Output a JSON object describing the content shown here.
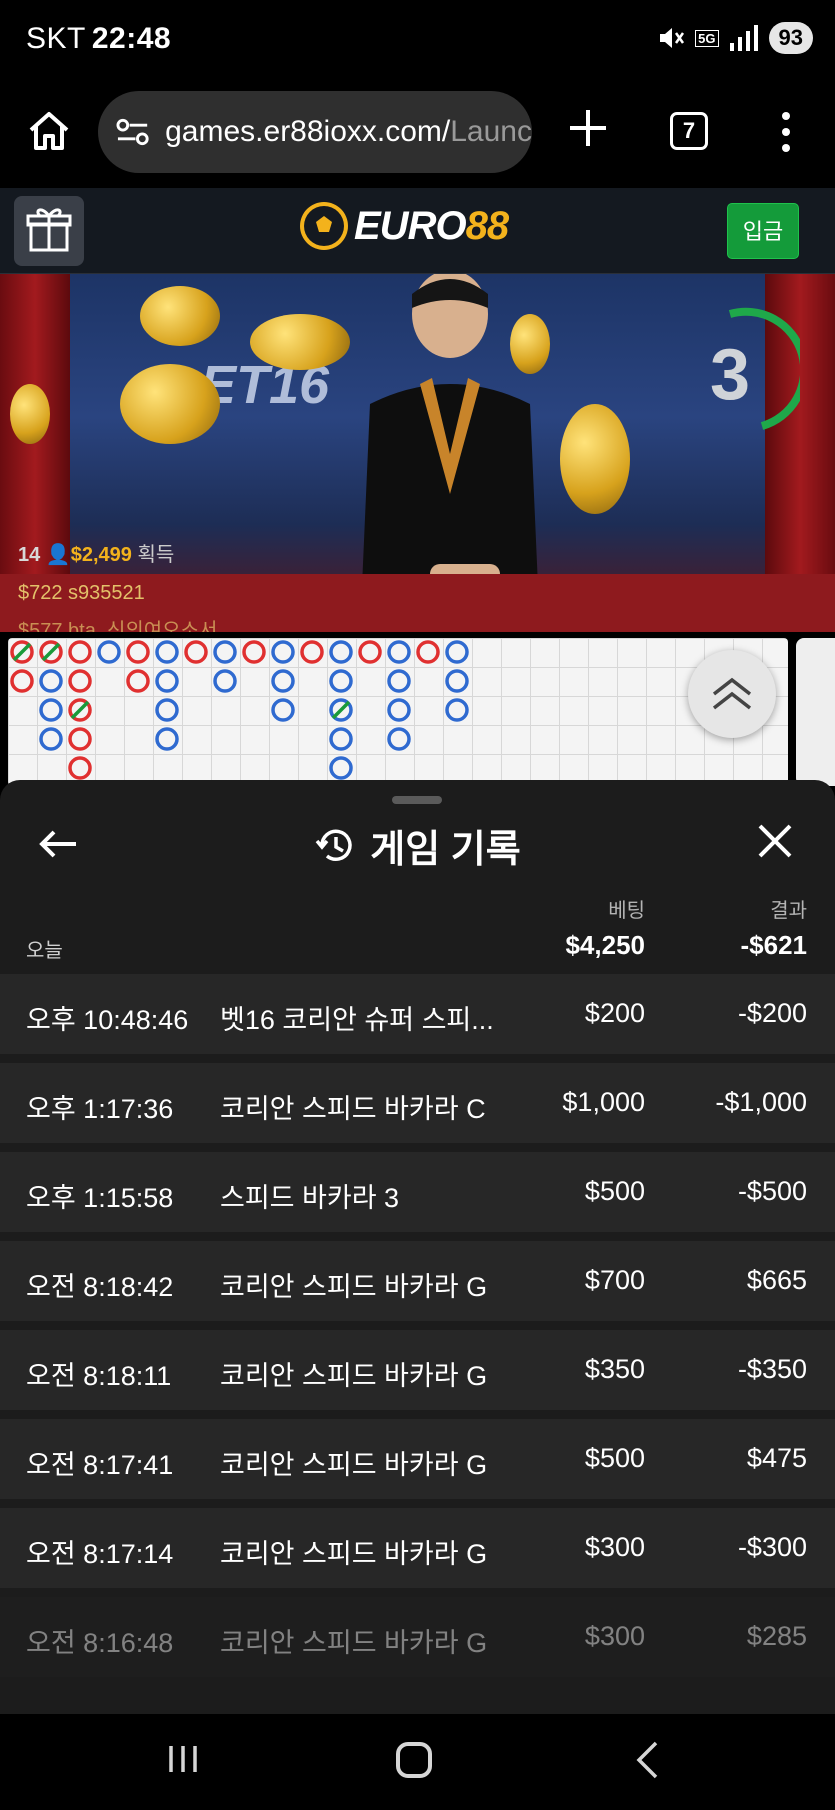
{
  "status_bar": {
    "carrier": "SKT",
    "time": "22:48",
    "network": "5G",
    "battery": "93"
  },
  "browser": {
    "url_visible": "games.er88ioxx.com/",
    "url_faded": "Launc",
    "tab_count": "7"
  },
  "site_header": {
    "logo_text": "EURO",
    "logo_number": "88",
    "deposit_label": "입금",
    "brand_color": "#f3b21c"
  },
  "video": {
    "table_name": "ET16",
    "countdown": "3",
    "winner_count": "14",
    "total_won": "$2,499",
    "won_label": "획득",
    "winner_2": "$722  s935521",
    "winner_3": "$577  bta_신의여오소서"
  },
  "history": {
    "title": "게임 기록",
    "col_bet": "베팅",
    "col_result": "결과",
    "today_label": "오늘",
    "today_bet": "$4,250",
    "today_result": "-$621",
    "rows": [
      {
        "time": "오후 10:48:46",
        "game": "벳16 코리안 슈퍼 스피...",
        "bet": "$200",
        "result": "-$200"
      },
      {
        "time": "오후 1:17:36",
        "game": "코리안 스피드 바카라 C",
        "bet": "$1,000",
        "result": "-$1,000"
      },
      {
        "time": "오후 1:15:58",
        "game": "스피드 바카라 3",
        "bet": "$500",
        "result": "-$500"
      },
      {
        "time": "오전 8:18:42",
        "game": "코리안 스피드 바카라 G",
        "bet": "$700",
        "result": "$665"
      },
      {
        "time": "오전 8:18:11",
        "game": "코리안 스피드 바카라 G",
        "bet": "$350",
        "result": "-$350"
      },
      {
        "time": "오전 8:17:41",
        "game": "코리안 스피드 바카라 G",
        "bet": "$500",
        "result": "$475"
      },
      {
        "time": "오전 8:17:14",
        "game": "코리안 스피드 바카라 G",
        "bet": "$300",
        "result": "-$300"
      },
      {
        "time": "오전 8:16:48",
        "game": "코리안 스피드 바카라 G",
        "bet": "$300",
        "result": "$285"
      }
    ]
  }
}
